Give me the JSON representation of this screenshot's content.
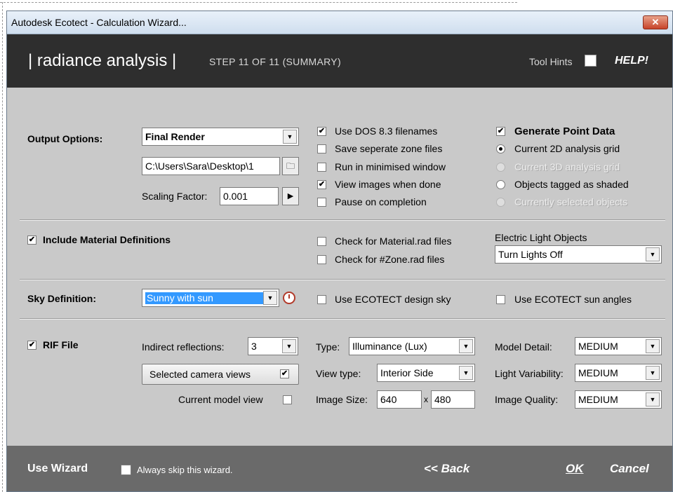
{
  "window": {
    "title": "Autodesk Ecotect - Calculation Wizard...",
    "close_glyph": "✕"
  },
  "banner": {
    "title": "| radiance analysis |",
    "step": "STEP 11 OF 11  (SUMMARY)",
    "tool_hints": "Tool Hints",
    "tool_hints_checked": false,
    "help": "HELP!"
  },
  "output_options": {
    "label": "Output Options:",
    "render_type": "Final Render",
    "path": "C:\\Users\\Sara\\Desktop\\1",
    "scaling_label": "Scaling Factor:",
    "scaling_value": "0.001"
  },
  "options": [
    {
      "label": "Use DOS 8.3 filenames",
      "checked": true
    },
    {
      "label": "Save seperate zone files",
      "checked": false
    },
    {
      "label": "Run in minimised window",
      "checked": false
    },
    {
      "label": "View images when done",
      "checked": true
    },
    {
      "label": "Pause on completion",
      "checked": false
    }
  ],
  "point_data": {
    "label": "Generate Point Data",
    "checked": true,
    "options": [
      {
        "label": "Current 2D analysis grid",
        "selected": true,
        "enabled": true
      },
      {
        "label": "Current 3D analysis grid",
        "selected": false,
        "enabled": false
      },
      {
        "label": "Objects tagged as shaded",
        "selected": false,
        "enabled": true
      },
      {
        "label": "Currently selected objects",
        "selected": false,
        "enabled": false
      }
    ]
  },
  "materials": {
    "label": "Include Material Definitions",
    "checked": true,
    "check_material": "Check for Material.rad files",
    "check_zone": "Check for #Zone.rad files",
    "electric_label": "Electric Light Objects",
    "electric_value": "Turn Lights Off"
  },
  "sky": {
    "label": "Sky Definition:",
    "value": "Sunny with sun",
    "design_sky": "Use ECOTECT design sky",
    "sun_angles": "Use ECOTECT sun angles"
  },
  "rif": {
    "label": "RIF File",
    "checked": true,
    "indirect_label": "Indirect reflections:",
    "indirect_value": "3",
    "camera_views": "Selected camera views",
    "camera_checked": true,
    "model_view": "Current model view",
    "model_checked": false,
    "type_label": "Type:",
    "type_value": "Illuminance (Lux)",
    "view_type_label": "View type:",
    "view_type_value": "Interior Side",
    "image_size_label": "Image Size:",
    "image_w": "640",
    "image_x": "x",
    "image_h": "480",
    "model_detail_label": "Model Detail:",
    "model_detail_value": "MEDIUM",
    "light_var_label": "Light Variability:",
    "light_var_value": "MEDIUM",
    "image_quality_label": "Image Quality:",
    "image_quality_value": "MEDIUM"
  },
  "footer": {
    "use_wizard": "Use Wizard",
    "skip_label": "Always skip this wizard.",
    "skip_checked": false,
    "back": "<< Back",
    "ok": "OK",
    "cancel": "Cancel"
  },
  "icons": {
    "folder": "folder-icon",
    "arrow": "play-arrow-icon",
    "clock": "clock-icon",
    "dropdown": "chevron-down-icon"
  }
}
